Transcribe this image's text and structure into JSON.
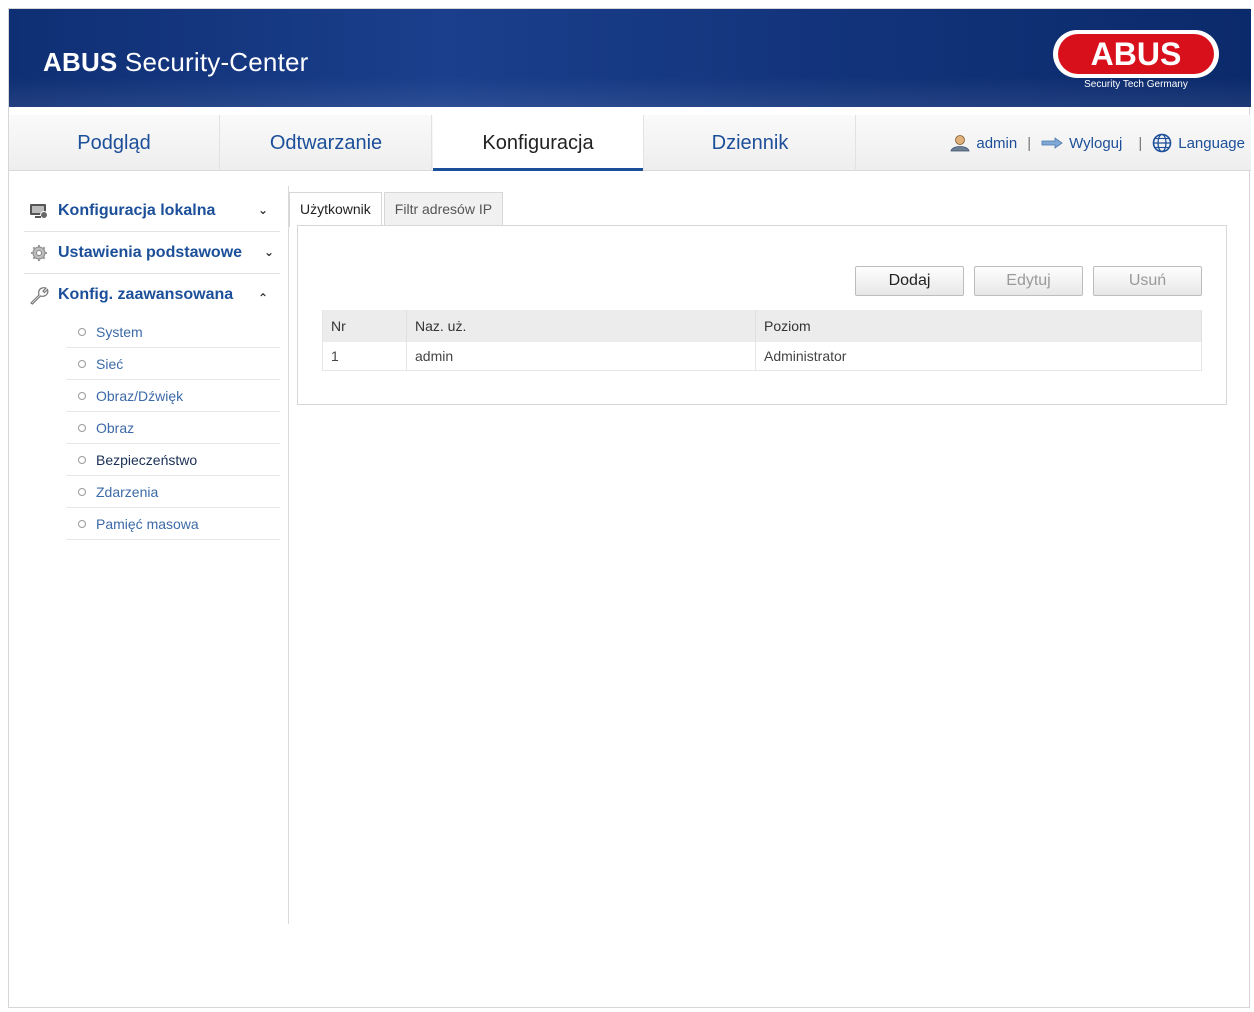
{
  "header": {
    "app_brand": "ABUS",
    "app_title": "Security-Center",
    "logo_text": "ABUS",
    "logo_tagline": "Security Tech Germany"
  },
  "nav": {
    "tabs": [
      {
        "label": "Podgląd",
        "active": false
      },
      {
        "label": "Odtwarzanie",
        "active": false
      },
      {
        "label": "Konfiguracja",
        "active": true
      },
      {
        "label": "Dziennik",
        "active": false
      }
    ],
    "user": "admin",
    "logout": "Wyloguj",
    "language": "Language",
    "separator": "|"
  },
  "sidebar": {
    "sections": [
      {
        "label": "Konfiguracja lokalna",
        "icon": "monitor-icon",
        "expanded": false
      },
      {
        "label": "Ustawienia podstawowe",
        "icon": "gear-icon",
        "expanded": false
      },
      {
        "label": "Konfig. zaawansowana",
        "icon": "wrench-icon",
        "expanded": true
      }
    ],
    "items": [
      {
        "label": "System"
      },
      {
        "label": "Sieć"
      },
      {
        "label": "Obraz/Dźwięk"
      },
      {
        "label": "Obraz"
      },
      {
        "label": "Bezpieczeństwo",
        "active": true
      },
      {
        "label": "Zdarzenia"
      },
      {
        "label": "Pamięć masowa"
      }
    ]
  },
  "content": {
    "tabs": [
      {
        "label": "Użytkownik",
        "active": true
      },
      {
        "label": "Filtr adresów IP",
        "active": false
      }
    ],
    "buttons": {
      "add": "Dodaj",
      "edit": "Edytuj",
      "delete": "Usuń"
    },
    "table": {
      "headers": [
        "Nr",
        "Naz. uż.",
        "Poziom"
      ],
      "rows": [
        [
          "1",
          "admin",
          "Administrator"
        ]
      ]
    }
  },
  "colors": {
    "header_blue": "#13347c",
    "link_blue": "#1c4f99",
    "logo_red": "#d8101c"
  }
}
